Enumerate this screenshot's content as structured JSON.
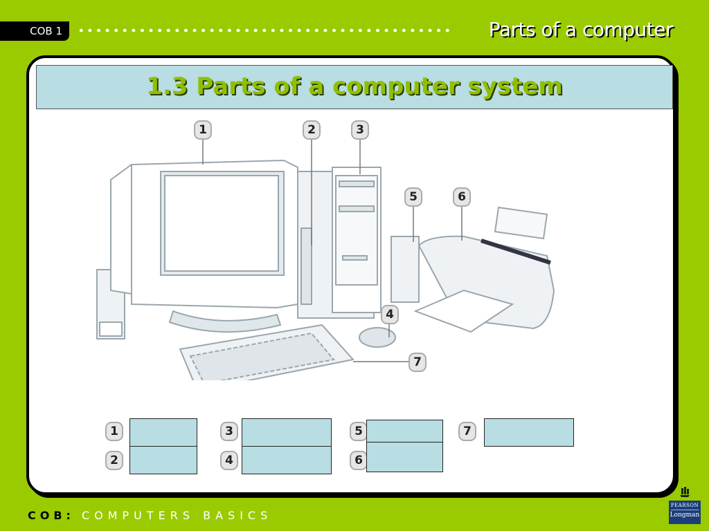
{
  "header": {
    "course_tag": "COB 1",
    "slide_title": "Parts of a computer"
  },
  "section_heading": "1.3 Parts of a computer system",
  "illustration": {
    "description": "Desktop computer system: monitor, speakers, system unit, mouse, keyboard, printer",
    "callouts": [
      "1",
      "2",
      "3",
      "4",
      "5",
      "6",
      "7"
    ]
  },
  "answer_grid": {
    "items": [
      {
        "number": "1",
        "value": ""
      },
      {
        "number": "2",
        "value": ""
      },
      {
        "number": "3",
        "value": ""
      },
      {
        "number": "4",
        "value": ""
      },
      {
        "number": "5",
        "value": ""
      },
      {
        "number": "6",
        "value": ""
      },
      {
        "number": "7",
        "value": ""
      }
    ]
  },
  "footer": {
    "course_code": "COB:",
    "course_name": "COMPUTERS BASICS"
  },
  "publisher_logo": {
    "line1": "PEARSON",
    "line2": "Longman"
  },
  "colors": {
    "background_green": "#9acb00",
    "heading_band": "#b8dde2",
    "heading_text": "#8fc000",
    "publisher_blue": "#1b3e7a"
  }
}
